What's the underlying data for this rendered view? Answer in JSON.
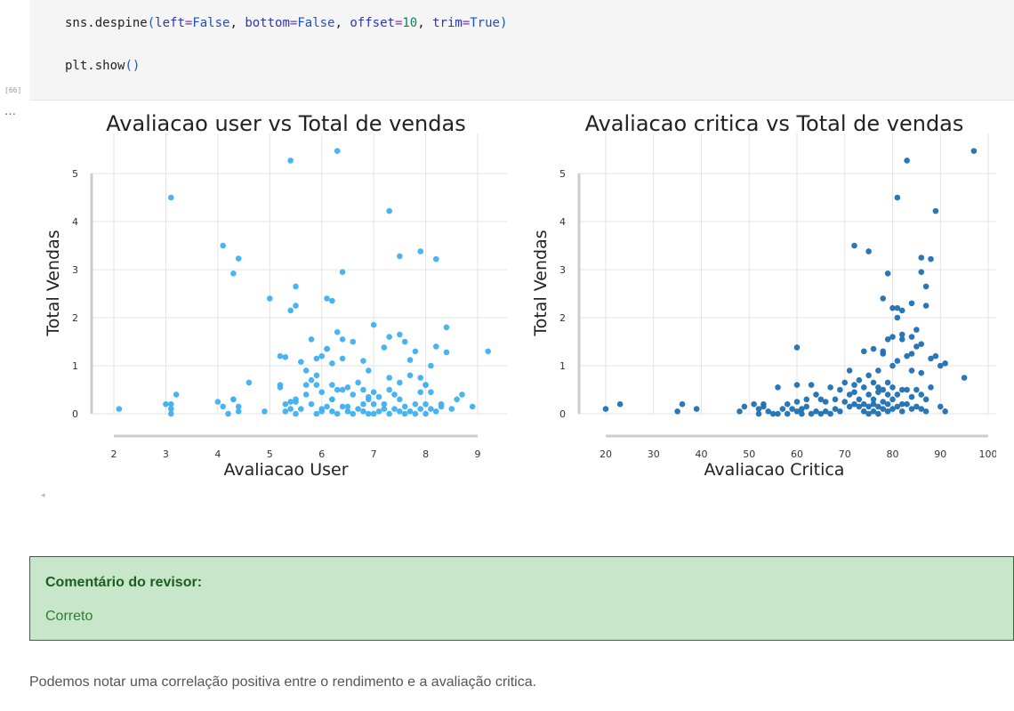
{
  "code": {
    "line1": {
      "fn": "sns.despine",
      "open": "(",
      "k1": "left",
      "v1": "False",
      "k2": "bottom",
      "v2": "False",
      "k3": "offset",
      "v3": "10",
      "k4": "trim",
      "v4": "True",
      "close": ")",
      "eq": "=",
      "sep": ", "
    },
    "line2": {
      "fn": "plt.show",
      "parens": "()"
    },
    "execution_count": "[66]"
  },
  "output": {
    "ellipsis": "…",
    "scroll_left": "◂"
  },
  "colors": {
    "user_points": "#3fb0f0",
    "critic_points": "#1f6fb2",
    "grid": "#e3e3e3",
    "spine": "#cccccc",
    "reviewer_bg": "#c8e6c9",
    "reviewer_border": "#2e6b2f"
  },
  "chart_data": [
    {
      "type": "scatter",
      "title": "Avaliacao user vs Total de vendas",
      "xlabel": "Avaliacao User",
      "ylabel": "Total Vendas",
      "xlim": [
        2,
        9
      ],
      "ylim": [
        0,
        5
      ],
      "xticks": [
        2,
        3,
        4,
        5,
        6,
        7,
        8,
        9
      ],
      "yticks": [
        0,
        1,
        2,
        3,
        4,
        5
      ],
      "grid": true,
      "color": "#3fb0f0",
      "x": [
        2.1,
        3.1,
        3.0,
        3.1,
        3.2,
        3.1,
        4.0,
        4.1,
        4.2,
        4.3,
        4.4,
        4.1,
        4.3,
        4.4,
        4.6,
        4.9,
        5.2,
        5.2,
        5.3,
        5.3,
        5.4,
        5.4,
        5.5,
        5.5,
        5.5,
        5.6,
        5.6,
        5.7,
        5.7,
        5.8,
        5.8,
        5.8,
        5.9,
        5.9,
        5.9,
        6.0,
        6.0,
        6.0,
        6.1,
        6.1,
        6.1,
        6.2,
        6.2,
        6.2,
        6.3,
        6.3,
        6.3,
        6.4,
        6.4,
        6.4,
        6.5,
        6.5,
        6.6,
        6.6,
        6.7,
        6.7,
        6.8,
        6.8,
        6.8,
        6.9,
        6.9,
        6.9,
        7.0,
        7.0,
        7.0,
        7.1,
        7.1,
        7.2,
        7.2,
        7.3,
        7.3,
        7.3,
        7.4,
        7.4,
        7.5,
        7.5,
        7.5,
        7.6,
        7.6,
        7.7,
        7.7,
        7.7,
        7.8,
        7.8,
        7.9,
        7.9,
        8.0,
        8.0,
        8.0,
        8.1,
        8.1,
        8.2,
        8.2,
        8.3,
        8.3,
        8.4,
        8.5,
        8.6,
        8.7,
        8.9,
        9.2,
        5.2,
        5.3,
        5.5,
        5.9,
        6.0,
        6.1,
        6.2,
        6.4,
        6.6,
        6.9,
        7.2,
        7.5,
        7.8,
        8.0,
        6.5,
        5.7,
        7.0,
        7.3,
        6.8,
        7.6,
        7.9,
        8.1,
        8.4,
        4.3,
        4.4,
        5.4,
        6.2,
        6.4,
        5.5,
        7.5,
        7.9,
        6.3,
        3.1,
        5.0,
        6.2,
        7.3,
        8.2
      ],
      "y": [
        0.1,
        0.0,
        0.2,
        0.2,
        0.4,
        0.1,
        0.25,
        0.15,
        0.0,
        0.3,
        0.15,
        3.5,
        2.92,
        3.23,
        0.65,
        0.05,
        1.2,
        0.55,
        1.18,
        0.05,
        0.25,
        0.1,
        0.3,
        0.0,
        2.65,
        0.1,
        1.08,
        0.6,
        0.9,
        0.2,
        1.55,
        0.7,
        0.6,
        0.0,
        1.15,
        0.05,
        0.45,
        1.2,
        0.15,
        1.35,
        2.4,
        0.05,
        0.3,
        1.05,
        0.0,
        0.5,
        1.7,
        0.15,
        0.5,
        1.55,
        0.05,
        0.15,
        0.0,
        0.4,
        0.1,
        0.65,
        0.2,
        0.05,
        0.5,
        0.0,
        0.3,
        0.9,
        0.0,
        0.2,
        0.45,
        0.05,
        0.35,
        0.1,
        0.2,
        0.0,
        0.5,
        0.75,
        0.1,
        0.4,
        0.05,
        0.3,
        1.65,
        0.0,
        0.15,
        0.05,
        0.8,
        1.12,
        0.0,
        0.2,
        0.1,
        0.45,
        0.0,
        0.2,
        0.6,
        0.1,
        0.45,
        0.05,
        1.4,
        0.15,
        0.2,
        1.28,
        0.1,
        0.3,
        0.4,
        0.15,
        1.3,
        0.6,
        0.2,
        0.25,
        0.8,
        0.1,
        1.35,
        0.3,
        1.15,
        1.5,
        0.35,
        1.38,
        0.65,
        1.3,
        0.6,
        0.55,
        0.4,
        1.85,
        1.6,
        1.1,
        1.5,
        0.75,
        1.0,
        1.8,
        0.3,
        0.05,
        2.15,
        2.35,
        2.95,
        2.25,
        3.28,
        3.38,
        5.47,
        4.5,
        2.4,
        0.6,
        4.22,
        3.22,
        2.25
      ],
      "series_extra_high": [
        {
          "x": 5.4,
          "y": 5.27
        }
      ]
    },
    {
      "type": "scatter",
      "title": "Avaliacao critica vs Total de vendas",
      "xlabel": "Avaliacao Critica",
      "ylabel": "Total Vendas",
      "xlim": [
        20,
        100
      ],
      "ylim": [
        0,
        5
      ],
      "xticks": [
        20,
        30,
        40,
        50,
        60,
        70,
        80,
        90,
        100
      ],
      "yticks": [
        0,
        1,
        2,
        3,
        4,
        5
      ],
      "grid": true,
      "color": "#1f6fb2",
      "x": [
        20,
        23,
        35,
        36,
        39,
        48,
        49,
        51,
        52,
        52,
        53,
        53,
        54,
        55,
        56,
        56,
        57,
        58,
        58,
        59,
        60,
        60,
        60,
        61,
        61,
        62,
        62,
        63,
        63,
        64,
        64,
        65,
        65,
        66,
        66,
        67,
        67,
        68,
        68,
        69,
        69,
        70,
        70,
        71,
        71,
        71,
        72,
        72,
        72,
        73,
        73,
        73,
        74,
        74,
        74,
        75,
        75,
        75,
        75,
        76,
        76,
        76,
        76,
        77,
        77,
        77,
        77,
        78,
        78,
        78,
        78,
        79,
        79,
        79,
        79,
        80,
        80,
        80,
        80,
        81,
        81,
        81,
        81,
        82,
        82,
        82,
        82,
        83,
        83,
        83,
        84,
        84,
        84,
        84,
        85,
        85,
        85,
        86,
        86,
        86,
        86,
        87,
        87,
        87,
        88,
        88,
        89,
        90,
        90,
        91,
        91,
        95,
        97,
        60,
        72,
        74,
        75,
        78,
        79,
        80,
        82,
        84,
        86,
        87,
        76,
        77,
        80,
        81,
        83,
        85,
        86,
        88,
        89,
        78,
        79,
        82,
        84,
        81
      ],
      "y": [
        0.1,
        0.2,
        0.05,
        0.2,
        0.1,
        0.05,
        0.15,
        0.2,
        0.0,
        0.1,
        0.15,
        0.2,
        0.05,
        0.0,
        0.0,
        0.55,
        0.1,
        0.0,
        0.2,
        0.1,
        0.25,
        0.05,
        0.6,
        0.0,
        0.1,
        0.15,
        0.3,
        0.0,
        0.6,
        0.05,
        0.4,
        0.0,
        0.3,
        0.05,
        0.25,
        0.0,
        0.55,
        0.1,
        0.3,
        0.05,
        0.5,
        0.25,
        0.65,
        0.15,
        0.4,
        0.9,
        0.2,
        0.45,
        0.6,
        0.15,
        0.3,
        0.7,
        0.05,
        0.2,
        0.55,
        0.0,
        0.15,
        0.4,
        0.8,
        0.05,
        0.2,
        0.3,
        0.65,
        0.0,
        0.15,
        0.45,
        0.9,
        0.1,
        0.25,
        0.5,
        1.25,
        0.05,
        0.2,
        0.4,
        0.65,
        0.1,
        0.3,
        0.55,
        1.0,
        0.15,
        0.4,
        1.1,
        2.0,
        0.05,
        0.2,
        0.5,
        1.65,
        0.2,
        0.5,
        1.2,
        0.1,
        0.35,
        0.9,
        2.3,
        0.15,
        0.5,
        1.4,
        0.1,
        0.4,
        0.85,
        2.95,
        0.05,
        0.3,
        2.25,
        0.55,
        1.15,
        1.2,
        1.0,
        0.15,
        0.05,
        1.05,
        0.75,
        5.47,
        1.38,
        3.5,
        1.3,
        3.38,
        2.4,
        1.55,
        2.2,
        2.15,
        1.6,
        3.25,
        2.65,
        1.35,
        0.55,
        1.6,
        2.2,
        5.27,
        1.75,
        1.45,
        3.22,
        4.22,
        1.3,
        2.92,
        1.55,
        1.25,
        4.5,
        1.9
      ],
      "series_extra_high": []
    }
  ],
  "review": {
    "title": "Comentário do revisor:",
    "text": "Correto"
  },
  "note": "Podemos notar uma correlação positiva entre o rendimento e a avaliação critica."
}
